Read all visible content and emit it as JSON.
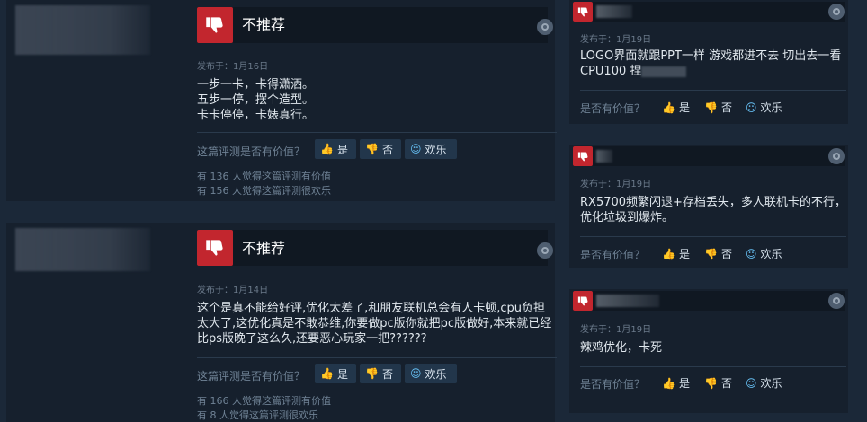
{
  "reviews_left": [
    {
      "verdict": "不推荐",
      "posted": "发布于：1月16日",
      "lines": [
        "一步一卡，卡得潇洒。",
        "五步一停，摆个造型。",
        "卡卡停停，卡婊真行。"
      ],
      "question": "这篇评测是否有价值？",
      "btn_yes": "是",
      "btn_no": "否",
      "btn_fun": "欢乐",
      "stat_helpful": "有 136 人觉得这篇评测有价值",
      "stat_funny": "有 156 人觉得这篇评测很欢乐"
    },
    {
      "verdict": "不推荐",
      "posted": "发布于：1月14日",
      "lines": [
        "这个是真不能给好评,优化太差了,和朋友联机总会有人卡顿,cpu负担",
        "太大了,这优化真是不敢恭维,你要做pc版你就把pc版做好,本来就已经",
        "比ps版晚了这么久,还要恶心玩家一把??????"
      ],
      "question": "这篇评测是否有价值？",
      "btn_yes": "是",
      "btn_no": "否",
      "btn_fun": "欢乐",
      "stat_helpful": "有 166 人觉得这篇评测有价值",
      "stat_funny": "有 8 人觉得这篇评测很欢乐"
    }
  ],
  "reviews_right": [
    {
      "posted": "发布于：1月19日",
      "line1": "LOGO界面就跟PPT一样 游戏都进不去 切出去一看",
      "line2": "CPU100 捏",
      "question": "是否有价值？",
      "btn_yes": "是",
      "btn_no": "否",
      "btn_fun": "欢乐"
    },
    {
      "posted": "发布于：1月19日",
      "line1": "RX5700频繁闪退+存档丢失，多人联机卡的不行，",
      "line2": "优化垃圾到爆炸。",
      "question": "是否有价值？",
      "btn_yes": "是",
      "btn_no": "否",
      "btn_fun": "欢乐"
    },
    {
      "posted": "发布于：1月19日",
      "line1": "辣鸡优化，卡死",
      "line2": "",
      "question": "是否有价值？",
      "btn_yes": "是",
      "btn_no": "否",
      "btn_fun": "欢乐"
    }
  ],
  "icons": {
    "thumb": "thumbs-down-icon",
    "steam": "steam-icon",
    "yes": "thumbs-up-icon",
    "no": "thumbs-down-icon",
    "fun": "smile-icon"
  },
  "colors": {
    "background": "#1b2838",
    "card": "#16202d",
    "thumb_red": "#c2262e",
    "button": "#22364b"
  }
}
